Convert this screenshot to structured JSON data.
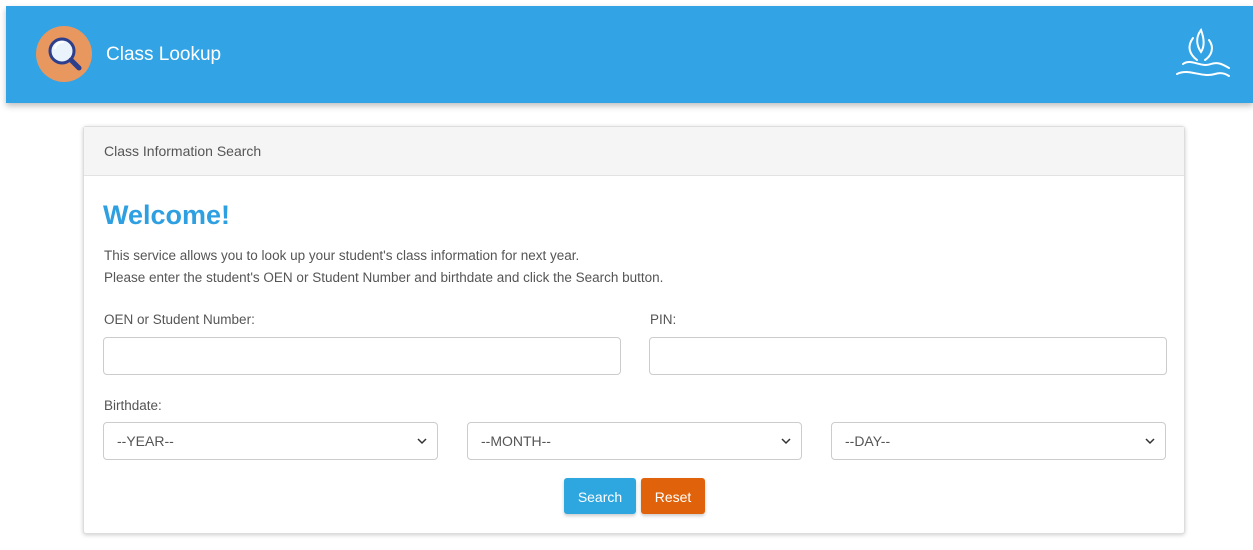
{
  "header": {
    "title": "Class Lookup",
    "logo_icon": "magnifier-icon",
    "brand_icon": "flame-swirl-icon",
    "bar_color": "#32a4e6",
    "logo_color": "#e8975f"
  },
  "card": {
    "header_title": "Class Information Search",
    "welcome": "Welcome!",
    "intro_line1": "This service allows you to look up your student's class information for next year.",
    "intro_line2": "Please enter the student's OEN or Student Number and birthdate and click the Search button."
  },
  "form": {
    "oen_label": "OEN or Student Number:",
    "oen_value": "",
    "pin_label": "PIN:",
    "pin_value": "",
    "birthdate_label": "Birthdate:",
    "year_selected": "--YEAR--",
    "month_selected": "--MONTH--",
    "day_selected": "--DAY--"
  },
  "buttons": {
    "search_label": "Search",
    "reset_label": "Reset",
    "search_color": "#2ea6df",
    "reset_color": "#e0620a"
  }
}
